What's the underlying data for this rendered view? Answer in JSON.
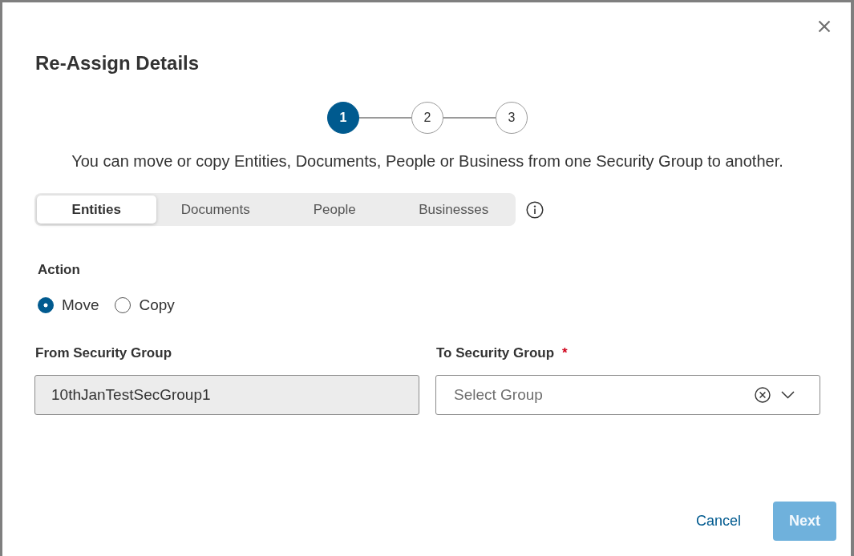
{
  "dialog": {
    "title": "Re-Assign Details",
    "stepper": {
      "steps": [
        {
          "label": "1",
          "selected": true
        },
        {
          "label": "2",
          "selected": false
        },
        {
          "label": "3",
          "selected": false
        }
      ]
    },
    "description": "You can move or copy Entities, Documents, People or Business from one Security Group to another.",
    "tabs": [
      {
        "label": "Entities",
        "selected": true
      },
      {
        "label": "Documents",
        "selected": false
      },
      {
        "label": "People",
        "selected": false
      },
      {
        "label": "Businesses",
        "selected": false
      }
    ],
    "action": {
      "label": "Action",
      "options": [
        {
          "label": "Move",
          "selected": true
        },
        {
          "label": "Copy",
          "selected": false
        }
      ]
    },
    "from_group": {
      "label": "From Security Group",
      "value": "10thJanTestSecGroup1",
      "disabled": true
    },
    "to_group": {
      "label": "To Security Group",
      "required_mark": "*",
      "placeholder": "Select Group"
    },
    "buttons": [
      {
        "label": "Cancel",
        "kind": "link",
        "disabled": false
      },
      {
        "label": "Next",
        "kind": "primary",
        "disabled": true
      }
    ]
  }
}
